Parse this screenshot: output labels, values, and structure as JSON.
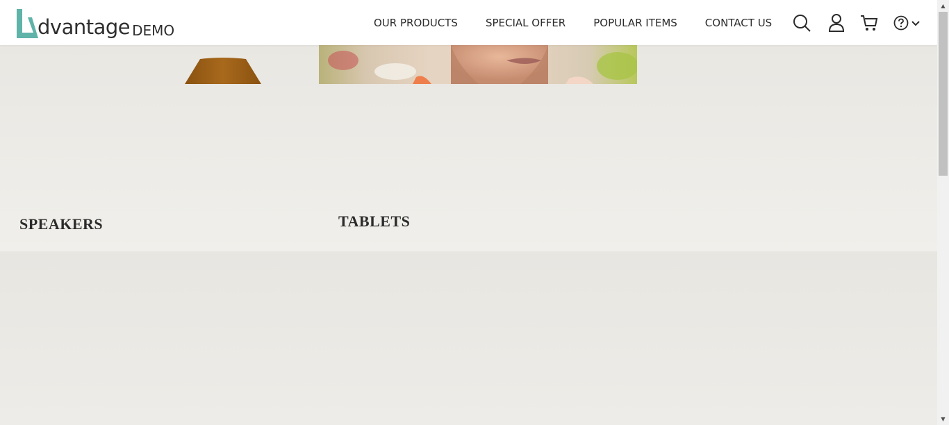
{
  "header": {
    "logo": {
      "brand": "dvantage",
      "sub": "DEMO",
      "accent_color": "#5fb3a8"
    },
    "nav": [
      {
        "label": "OUR PRODUCTS"
      },
      {
        "label": "SPECIAL OFFER"
      },
      {
        "label": "POPULAR ITEMS"
      },
      {
        "label": "CONTACT US"
      }
    ],
    "icons": [
      "search-icon",
      "user-icon",
      "cart-icon",
      "help-icon",
      "chevron-down-icon"
    ]
  },
  "categories": {
    "speakers": {
      "label": "SPEAKERS"
    },
    "tablets": {
      "label": "TABLETS"
    }
  },
  "colors": {
    "background": "#ebe9e4",
    "header": "#ffffff",
    "speaker_cap": "#9a5d14"
  }
}
